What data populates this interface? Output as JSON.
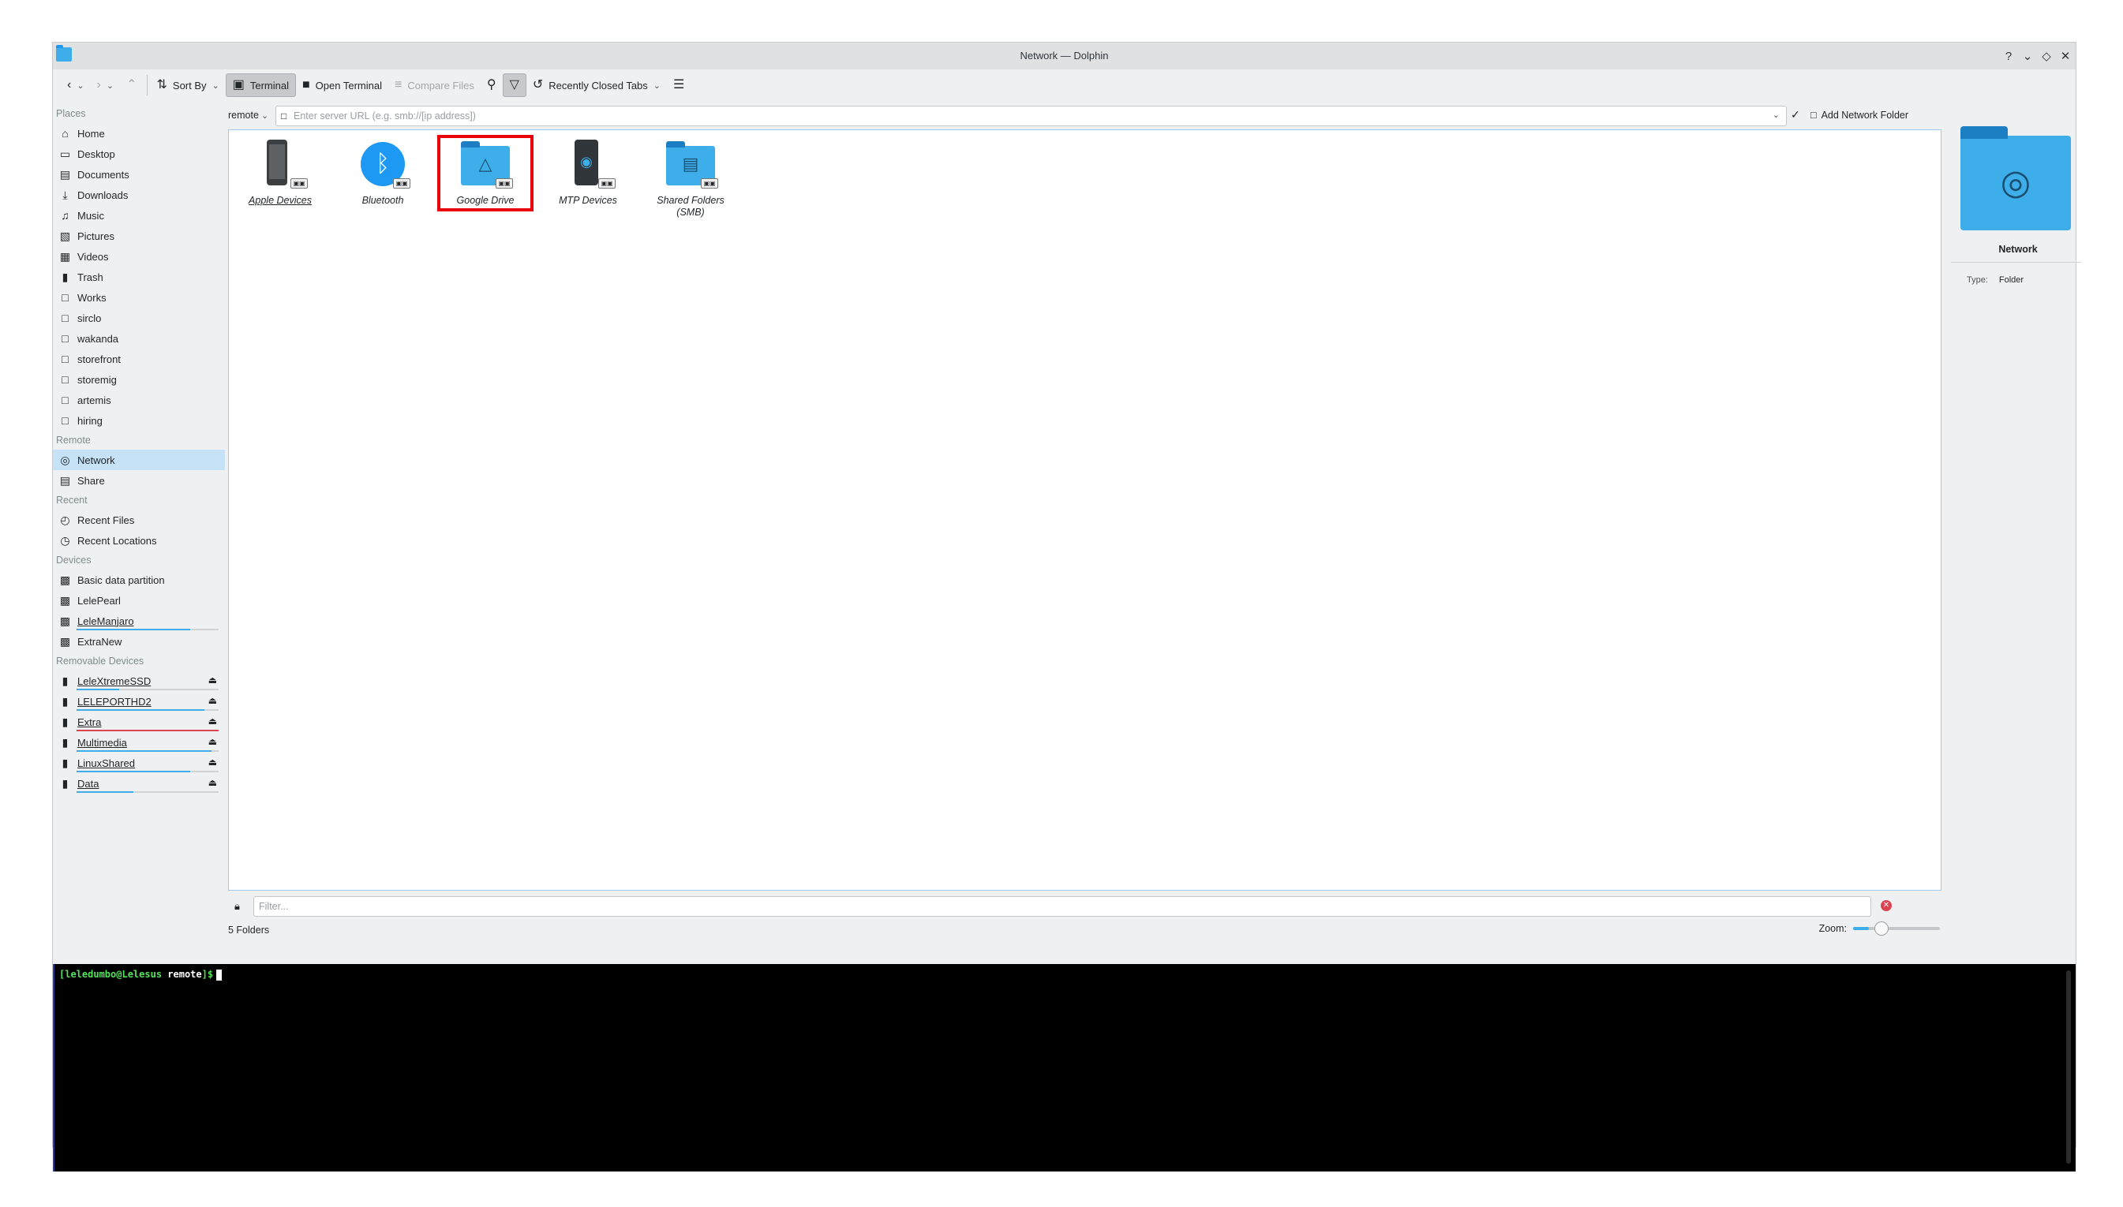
{
  "window": {
    "title": "Network — Dolphin",
    "controls": [
      "?",
      "⌄",
      "◇",
      "✕"
    ]
  },
  "toolbar": {
    "sort_by": "Sort By",
    "terminal": "Terminal",
    "open_terminal": "Open Terminal",
    "compare_files": "Compare Files",
    "recently_closed_tabs": "Recently Closed Tabs"
  },
  "sidebar": {
    "places_title": "Places",
    "places": [
      "Home",
      "Desktop",
      "Documents",
      "Downloads",
      "Music",
      "Pictures",
      "Videos",
      "Trash",
      "Works",
      "sirclo",
      "wakanda",
      "storefront",
      "storemig",
      "artemis",
      "hiring"
    ],
    "remote_title": "Remote",
    "remote": [
      "Network",
      "Share"
    ],
    "recent_title": "Recent",
    "recent": [
      "Recent Files",
      "Recent Locations"
    ],
    "devices_title": "Devices",
    "devices": [
      "Basic data partition",
      "LelePearl",
      "LeleManjaro",
      "ExtraNew"
    ],
    "removable_title": "Removable Devices",
    "removable": [
      {
        "name": "LeleXtremeSSD",
        "usage": 0.3
      },
      {
        "name": "LELEPORTHD2",
        "usage": 0.9
      },
      {
        "name": "Extra",
        "usage": 1.0,
        "critical": true
      },
      {
        "name": "Multimedia",
        "usage": 0.95
      },
      {
        "name": "LinuxShared",
        "usage": 0.8
      },
      {
        "name": "Data",
        "usage": 0.4
      }
    ]
  },
  "location": {
    "prefix": "remote",
    "placeholder": "Enter server URL (e.g. smb://[ip address])",
    "add_network_folder": "Add Network Folder"
  },
  "items": [
    "Apple Devices",
    "Bluetooth",
    "Google Drive",
    "MTP Devices",
    "Shared Folders (SMB)"
  ],
  "filter": {
    "placeholder": "Filter..."
  },
  "status": {
    "count": "5 Folders",
    "zoom_label": "Zoom:",
    "zoom_level": 0.18
  },
  "info": {
    "name": "Network",
    "type_label": "Type:",
    "type_value": "Folder"
  },
  "terminal": {
    "user": "[leledumbo@Lelesus",
    "dir": "remote",
    "suffix": "]$"
  },
  "colors": {
    "accent": "#3daee9",
    "highlight": "#e8000b",
    "selected": "#c6e2f7"
  }
}
